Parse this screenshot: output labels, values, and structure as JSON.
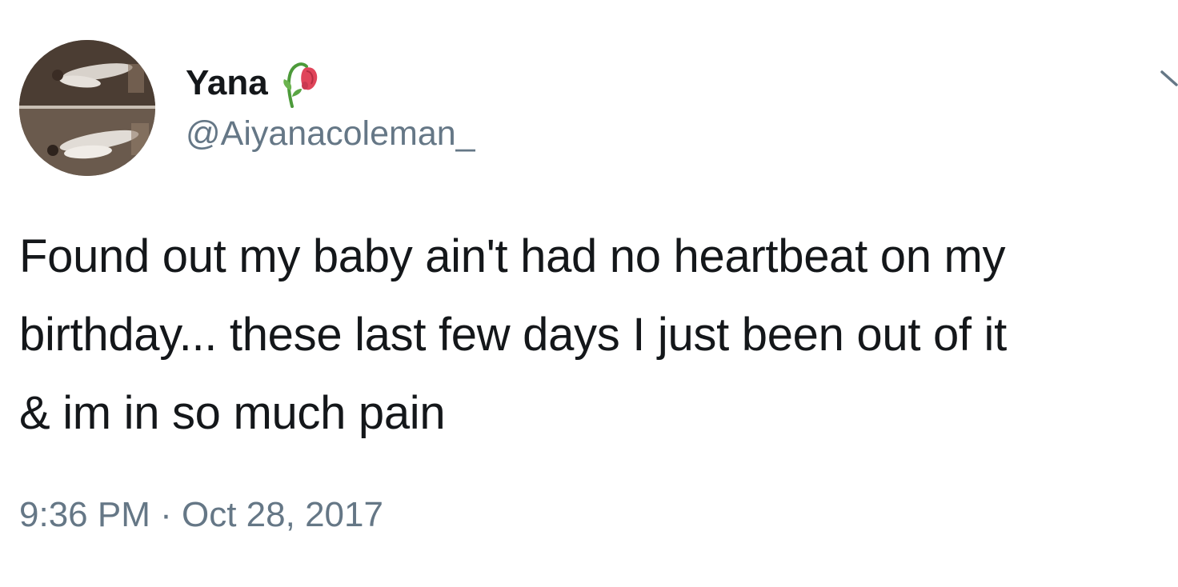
{
  "author": {
    "display_name": "Yana",
    "name_emoji": "wilted-flower-icon",
    "handle": "@Aiyanacoleman_"
  },
  "tweet": {
    "lines": [
      "Found out my baby ain't had no heartbeat on my",
      "birthday... these last few days I just been out of it",
      "& im in so much pain"
    ]
  },
  "meta": {
    "time": "9:36 PM",
    "separator": "·",
    "date": "Oct 28, 2017"
  },
  "colors": {
    "text": "#14171a",
    "secondary": "#657786",
    "background": "#ffffff"
  },
  "icons": {
    "menu": "chevron-down-icon"
  }
}
